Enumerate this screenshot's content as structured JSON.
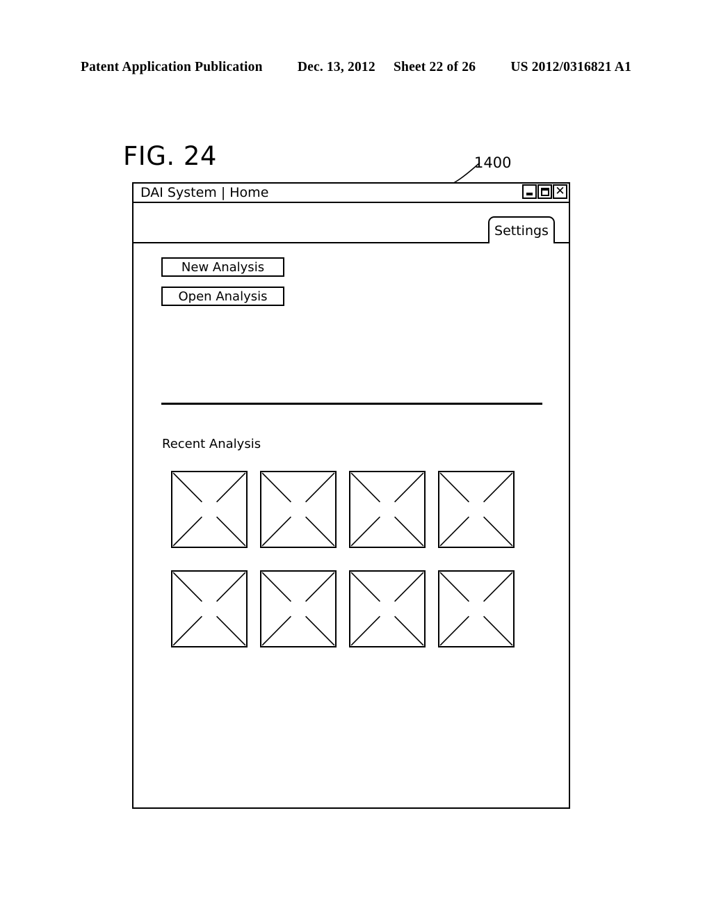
{
  "patent_header": {
    "publication": "Patent Application Publication",
    "date": "Dec. 13, 2012",
    "sheet": "Sheet 22 of 26",
    "number": "US 2012/0316821 A1"
  },
  "figure": {
    "label": "FIG. 24",
    "reference_numeral": "1400"
  },
  "window": {
    "title": "DAI System | Home",
    "controls": [
      {
        "name": "minimize",
        "glyph": "_"
      },
      {
        "name": "maximize",
        "glyph": "□"
      },
      {
        "name": "close",
        "glyph": "✕"
      }
    ],
    "tabs": [
      {
        "label": "Settings",
        "active": true
      }
    ],
    "content": {
      "buttons": [
        {
          "label": "New Analysis"
        },
        {
          "label": "Open Analysis"
        }
      ],
      "section_heading": "Recent Analysis",
      "thumbnails": {
        "count": 8,
        "columns": 4,
        "rows": 2,
        "placeholder_style": "crossed-square"
      }
    }
  },
  "colors": {
    "ink": "#000000",
    "paper": "#ffffff"
  }
}
